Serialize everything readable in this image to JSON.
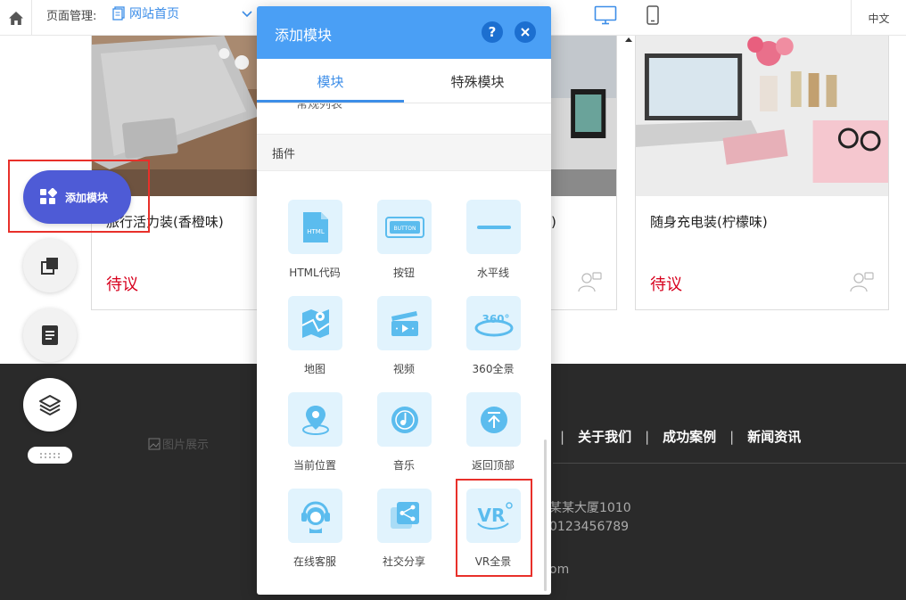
{
  "topbar": {
    "page_management_label": "页面管理:",
    "current_page": "网站首页",
    "language": "中文"
  },
  "products": [
    {
      "name": "旅行活力装(香橙味)",
      "price": "待议"
    },
    {
      "name": "味)",
      "price": ""
    },
    {
      "name": "随身充电装(柠檬味)",
      "price": "待议"
    }
  ],
  "footer": {
    "image_alt": "图片展示",
    "nav": [
      "关于我们",
      "成功案例",
      "新闻资讯"
    ],
    "separator": "|",
    "lines": [
      "某某大厦1010",
      "0123456789",
      "om"
    ]
  },
  "left_toolbar": {
    "add_module_label": "添加模块"
  },
  "dialog": {
    "title": "添加模块",
    "help_symbol": "?",
    "tabs": [
      {
        "label": "模块",
        "active": true
      },
      {
        "label": "特殊模块",
        "active": false
      }
    ],
    "cut_text": "常规列表",
    "section_title": "插件",
    "modules": [
      {
        "label": "HTML代码",
        "icon": "html-icon",
        "tile_text": "HTML"
      },
      {
        "label": "按钮",
        "icon": "button-icon",
        "tile_text": "BUTTON"
      },
      {
        "label": "水平线",
        "icon": "horizontal-line-icon"
      },
      {
        "label": "地图",
        "icon": "map-icon"
      },
      {
        "label": "视频",
        "icon": "video-icon"
      },
      {
        "label": "360全景",
        "icon": "panorama-360-icon",
        "tile_text": "360°"
      },
      {
        "label": "当前位置",
        "icon": "location-pin-icon"
      },
      {
        "label": "音乐",
        "icon": "music-disc-icon"
      },
      {
        "label": "返回顶部",
        "icon": "back-to-top-icon"
      },
      {
        "label": "在线客服",
        "icon": "customer-service-icon"
      },
      {
        "label": "社交分享",
        "icon": "share-icon"
      },
      {
        "label": "VR全景",
        "icon": "vr-icon",
        "tile_text": "VR"
      }
    ]
  },
  "colors": {
    "accent_blue": "#4a9ff5",
    "add_button": "#4e5bd6",
    "price_red": "#d7001d",
    "highlight_red": "#e8302a",
    "tile_bg": "#e1f3fd",
    "icon_blue": "#53b8ec",
    "footer_bg": "#2a2a2a"
  }
}
